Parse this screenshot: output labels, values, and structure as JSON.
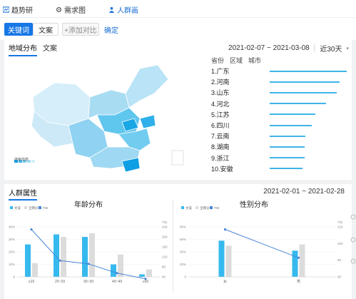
{
  "nav": {
    "tabs": [
      {
        "label": "趋势研",
        "icon": "trend-icon"
      },
      {
        "label": "需求图",
        "icon": "gear-icon"
      },
      {
        "label": "人群画",
        "icon": "person-icon"
      }
    ]
  },
  "toolbar": {
    "keyword_btn": "关键词",
    "text_btn": "文案",
    "add_compare": "+添加对比",
    "confirm": "确定"
  },
  "region": {
    "tabs": [
      "地域分布",
      "文案"
    ],
    "date_range": "2021-02-07 ~ 2021-03-08",
    "period": "近30天",
    "rank_headers": [
      "省份",
      "区域",
      "城市"
    ],
    "rankings": [
      {
        "label": "1.广东",
        "value": 1.0
      },
      {
        "label": "2.河南",
        "value": 0.91
      },
      {
        "label": "3.山东",
        "value": 0.87
      },
      {
        "label": "4.河北",
        "value": 0.73
      },
      {
        "label": "5.江苏",
        "value": 0.59
      },
      {
        "label": "6.四川",
        "value": 0.55
      },
      {
        "label": "7.云南",
        "value": 0.46
      },
      {
        "label": "8.湖南",
        "value": 0.45
      },
      {
        "label": "9.浙江",
        "value": 0.45
      },
      {
        "label": "10.安徽",
        "value": 0.43
      }
    ],
    "map_legend": "搜索指数"
  },
  "demographics": {
    "title": "人群属性",
    "date_range": "2021-02-01 ~ 2021-02-28",
    "legend": [
      "文案",
      "全网分布",
      "TGI"
    ]
  },
  "chart_data": [
    {
      "type": "bar",
      "title": "年龄分布",
      "categories": [
        "≤19",
        "20~29",
        "30~39",
        "40~49",
        "≥50"
      ],
      "series": [
        {
          "name": "文案",
          "values": [
            0.26,
            0.34,
            0.32,
            0.1,
            0.02
          ],
          "color": "#36b9ee"
        },
        {
          "name": "全网分布",
          "values": [
            0.11,
            0.32,
            0.35,
            0.18,
            0.06
          ],
          "color": "#dcdcdc"
        },
        {
          "name": "TGI",
          "values": [
            230,
            105,
            92,
            55,
            32
          ],
          "color": "#4a86d8"
        }
      ],
      "y_left_ticks": [
        "0",
        "10%",
        "20%",
        "30%",
        "40%"
      ],
      "y_right_ticks": [
        "40",
        "80",
        "120",
        "160",
        "200",
        "240"
      ],
      "y_right_label": "TGI",
      "ylim_left": [
        0,
        0.4
      ],
      "ylim_right": [
        40,
        240
      ]
    },
    {
      "type": "bar",
      "title": "性别分布",
      "categories": [
        "女",
        "男"
      ],
      "series": [
        {
          "name": "文案",
          "values": [
            0.58,
            0.42
          ],
          "color": "#36b9ee"
        },
        {
          "name": "全网分布",
          "values": [
            0.5,
            0.52
          ],
          "color": "#dcdcdc"
        },
        {
          "name": "TGI",
          "values": [
            117,
            83
          ],
          "color": "#4a86d8"
        }
      ],
      "y_left_ticks": [
        "0",
        "20%",
        "40%",
        "60%",
        "80%"
      ],
      "y_right_ticks": [
        "60",
        "80",
        "100",
        "120"
      ],
      "y_right_label": "TGI",
      "ylim_left": [
        0,
        0.8
      ],
      "ylim_right": [
        60,
        120
      ]
    }
  ]
}
